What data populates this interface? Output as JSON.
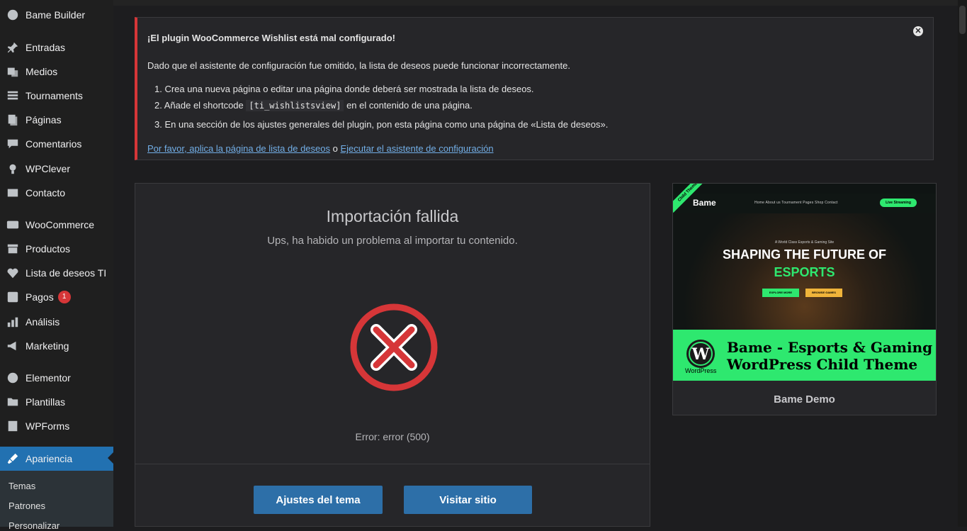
{
  "sidebar": {
    "items": [
      {
        "label": "Bame Builder",
        "icon": "globe-icon"
      },
      {
        "label": "Entradas",
        "icon": "pin-icon"
      },
      {
        "label": "Medios",
        "icon": "media-icon"
      },
      {
        "label": "Tournaments",
        "icon": "list-icon"
      },
      {
        "label": "Páginas",
        "icon": "pages-icon"
      },
      {
        "label": "Comentarios",
        "icon": "comment-icon"
      },
      {
        "label": "WPClever",
        "icon": "bulb-icon"
      },
      {
        "label": "Contacto",
        "icon": "mail-icon"
      },
      {
        "label": "WooCommerce",
        "icon": "woo-icon"
      },
      {
        "label": "Productos",
        "icon": "archive-icon"
      },
      {
        "label": "Lista de deseos TI",
        "icon": "heart-icon"
      },
      {
        "label": "Pagos",
        "icon": "dollar-icon",
        "badge": "1"
      },
      {
        "label": "Análisis",
        "icon": "chart-icon"
      },
      {
        "label": "Marketing",
        "icon": "megaphone-icon"
      },
      {
        "label": "Elementor",
        "icon": "elementor-icon"
      },
      {
        "label": "Plantillas",
        "icon": "folder-icon"
      },
      {
        "label": "WPForms",
        "icon": "form-icon"
      },
      {
        "label": "Apariencia",
        "icon": "brush-icon"
      }
    ],
    "submenu": [
      "Temas",
      "Patrones",
      "Personalizar"
    ]
  },
  "notice": {
    "title": "¡El plugin WooCommerce Wishlist está mal configurado!",
    "description": "Dado que el asistente de configuración fue omitido, la lista de deseos puede funcionar incorrectamente.",
    "step1": "1. Crea una nueva página o editar una página donde deberá ser mostrada la lista de deseos.",
    "step2_before": "2. Añade el shortcode",
    "step2_code": "[ti_wishlistsview]",
    "step2_after": "en el contenido de una página.",
    "step3": "3. En una sección de los ajustes generales del plugin, pon esta página como una página de «Lista de deseos».",
    "link1": "Por favor, aplica la página de lista de deseos",
    "link_separator": "o",
    "link2": "Ejecutar el asistente de configuración",
    "close_icon": "close-icon"
  },
  "import": {
    "title": "Importación fallida",
    "subtitle": "Ups, ha habido un problema al importar tu contenido.",
    "error": "Error: error (500)",
    "error_icon": "error-x-icon",
    "error_color": "#d63638",
    "button_settings": "Ajustes del tema",
    "button_visit": "Visitar sitio"
  },
  "theme_card": {
    "label": "Bame Demo",
    "preview": {
      "ribbon": "Child Theme",
      "logo": "Bame",
      "menu": "Home   About us   Tournament   Pages   Shop   Contact",
      "cta": "Live Streaming",
      "tagline": "A World Class Esports & Gaming Site",
      "headline1": "SHAPING THE FUTURE OF",
      "headline2": "ESPORTS",
      "btn1": "EXPLORE MORE",
      "btn2": "BROWSE GAMES",
      "wp_label": "WordPress",
      "band_title_line1": "Bame - Esports & Gaming",
      "band_title_line2": "WordPress Child Theme",
      "accent": "#2ee86f"
    }
  },
  "colors": {
    "accent_blue": "#2271b1",
    "button_blue": "#2d6fa8",
    "notice_red": "#d63638"
  }
}
